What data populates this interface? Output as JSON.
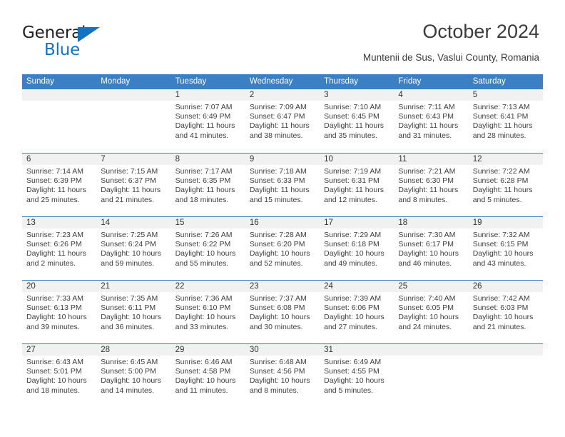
{
  "brand": {
    "line1": "General",
    "line2": "Blue",
    "accent_color": "#1273c4"
  },
  "header": {
    "month_title": "October 2024",
    "location": "Muntenii de Sus, Vaslui County, Romania"
  },
  "theme": {
    "header_blue": "#3b7fc4",
    "day_band_gray": "#f1f1f1",
    "text_color": "#3d3d3d"
  },
  "weekdays": [
    "Sunday",
    "Monday",
    "Tuesday",
    "Wednesday",
    "Thursday",
    "Friday",
    "Saturday"
  ],
  "weeks": [
    [
      {
        "day": "",
        "empty": true
      },
      {
        "day": "",
        "empty": true
      },
      {
        "day": "1",
        "sunrise": "Sunrise: 7:07 AM",
        "sunset": "Sunset: 6:49 PM",
        "daylight1": "Daylight: 11 hours",
        "daylight2": "and 41 minutes."
      },
      {
        "day": "2",
        "sunrise": "Sunrise: 7:09 AM",
        "sunset": "Sunset: 6:47 PM",
        "daylight1": "Daylight: 11 hours",
        "daylight2": "and 38 minutes."
      },
      {
        "day": "3",
        "sunrise": "Sunrise: 7:10 AM",
        "sunset": "Sunset: 6:45 PM",
        "daylight1": "Daylight: 11 hours",
        "daylight2": "and 35 minutes."
      },
      {
        "day": "4",
        "sunrise": "Sunrise: 7:11 AM",
        "sunset": "Sunset: 6:43 PM",
        "daylight1": "Daylight: 11 hours",
        "daylight2": "and 31 minutes."
      },
      {
        "day": "5",
        "sunrise": "Sunrise: 7:13 AM",
        "sunset": "Sunset: 6:41 PM",
        "daylight1": "Daylight: 11 hours",
        "daylight2": "and 28 minutes."
      }
    ],
    [
      {
        "day": "6",
        "sunrise": "Sunrise: 7:14 AM",
        "sunset": "Sunset: 6:39 PM",
        "daylight1": "Daylight: 11 hours",
        "daylight2": "and 25 minutes."
      },
      {
        "day": "7",
        "sunrise": "Sunrise: 7:15 AM",
        "sunset": "Sunset: 6:37 PM",
        "daylight1": "Daylight: 11 hours",
        "daylight2": "and 21 minutes."
      },
      {
        "day": "8",
        "sunrise": "Sunrise: 7:17 AM",
        "sunset": "Sunset: 6:35 PM",
        "daylight1": "Daylight: 11 hours",
        "daylight2": "and 18 minutes."
      },
      {
        "day": "9",
        "sunrise": "Sunrise: 7:18 AM",
        "sunset": "Sunset: 6:33 PM",
        "daylight1": "Daylight: 11 hours",
        "daylight2": "and 15 minutes."
      },
      {
        "day": "10",
        "sunrise": "Sunrise: 7:19 AM",
        "sunset": "Sunset: 6:31 PM",
        "daylight1": "Daylight: 11 hours",
        "daylight2": "and 12 minutes."
      },
      {
        "day": "11",
        "sunrise": "Sunrise: 7:21 AM",
        "sunset": "Sunset: 6:30 PM",
        "daylight1": "Daylight: 11 hours",
        "daylight2": "and 8 minutes."
      },
      {
        "day": "12",
        "sunrise": "Sunrise: 7:22 AM",
        "sunset": "Sunset: 6:28 PM",
        "daylight1": "Daylight: 11 hours",
        "daylight2": "and 5 minutes."
      }
    ],
    [
      {
        "day": "13",
        "sunrise": "Sunrise: 7:23 AM",
        "sunset": "Sunset: 6:26 PM",
        "daylight1": "Daylight: 11 hours",
        "daylight2": "and 2 minutes."
      },
      {
        "day": "14",
        "sunrise": "Sunrise: 7:25 AM",
        "sunset": "Sunset: 6:24 PM",
        "daylight1": "Daylight: 10 hours",
        "daylight2": "and 59 minutes."
      },
      {
        "day": "15",
        "sunrise": "Sunrise: 7:26 AM",
        "sunset": "Sunset: 6:22 PM",
        "daylight1": "Daylight: 10 hours",
        "daylight2": "and 55 minutes."
      },
      {
        "day": "16",
        "sunrise": "Sunrise: 7:28 AM",
        "sunset": "Sunset: 6:20 PM",
        "daylight1": "Daylight: 10 hours",
        "daylight2": "and 52 minutes."
      },
      {
        "day": "17",
        "sunrise": "Sunrise: 7:29 AM",
        "sunset": "Sunset: 6:18 PM",
        "daylight1": "Daylight: 10 hours",
        "daylight2": "and 49 minutes."
      },
      {
        "day": "18",
        "sunrise": "Sunrise: 7:30 AM",
        "sunset": "Sunset: 6:17 PM",
        "daylight1": "Daylight: 10 hours",
        "daylight2": "and 46 minutes."
      },
      {
        "day": "19",
        "sunrise": "Sunrise: 7:32 AM",
        "sunset": "Sunset: 6:15 PM",
        "daylight1": "Daylight: 10 hours",
        "daylight2": "and 43 minutes."
      }
    ],
    [
      {
        "day": "20",
        "sunrise": "Sunrise: 7:33 AM",
        "sunset": "Sunset: 6:13 PM",
        "daylight1": "Daylight: 10 hours",
        "daylight2": "and 39 minutes."
      },
      {
        "day": "21",
        "sunrise": "Sunrise: 7:35 AM",
        "sunset": "Sunset: 6:11 PM",
        "daylight1": "Daylight: 10 hours",
        "daylight2": "and 36 minutes."
      },
      {
        "day": "22",
        "sunrise": "Sunrise: 7:36 AM",
        "sunset": "Sunset: 6:10 PM",
        "daylight1": "Daylight: 10 hours",
        "daylight2": "and 33 minutes."
      },
      {
        "day": "23",
        "sunrise": "Sunrise: 7:37 AM",
        "sunset": "Sunset: 6:08 PM",
        "daylight1": "Daylight: 10 hours",
        "daylight2": "and 30 minutes."
      },
      {
        "day": "24",
        "sunrise": "Sunrise: 7:39 AM",
        "sunset": "Sunset: 6:06 PM",
        "daylight1": "Daylight: 10 hours",
        "daylight2": "and 27 minutes."
      },
      {
        "day": "25",
        "sunrise": "Sunrise: 7:40 AM",
        "sunset": "Sunset: 6:05 PM",
        "daylight1": "Daylight: 10 hours",
        "daylight2": "and 24 minutes."
      },
      {
        "day": "26",
        "sunrise": "Sunrise: 7:42 AM",
        "sunset": "Sunset: 6:03 PM",
        "daylight1": "Daylight: 10 hours",
        "daylight2": "and 21 minutes."
      }
    ],
    [
      {
        "day": "27",
        "sunrise": "Sunrise: 6:43 AM",
        "sunset": "Sunset: 5:01 PM",
        "daylight1": "Daylight: 10 hours",
        "daylight2": "and 18 minutes."
      },
      {
        "day": "28",
        "sunrise": "Sunrise: 6:45 AM",
        "sunset": "Sunset: 5:00 PM",
        "daylight1": "Daylight: 10 hours",
        "daylight2": "and 14 minutes."
      },
      {
        "day": "29",
        "sunrise": "Sunrise: 6:46 AM",
        "sunset": "Sunset: 4:58 PM",
        "daylight1": "Daylight: 10 hours",
        "daylight2": "and 11 minutes."
      },
      {
        "day": "30",
        "sunrise": "Sunrise: 6:48 AM",
        "sunset": "Sunset: 4:56 PM",
        "daylight1": "Daylight: 10 hours",
        "daylight2": "and 8 minutes."
      },
      {
        "day": "31",
        "sunrise": "Sunrise: 6:49 AM",
        "sunset": "Sunset: 4:55 PM",
        "daylight1": "Daylight: 10 hours",
        "daylight2": "and 5 minutes."
      },
      {
        "day": "",
        "empty": true
      },
      {
        "day": "",
        "empty": true
      }
    ]
  ]
}
